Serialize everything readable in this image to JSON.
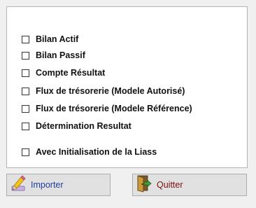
{
  "options": [
    {
      "label": "Bilan Actif",
      "checked": false
    },
    {
      "label": "Bilan Passif",
      "checked": false
    },
    {
      "label": "Compte Résultat",
      "checked": false
    },
    {
      "label": "Flux de trésorerie (Modele Autorisé)",
      "checked": false
    },
    {
      "label": "Flux de trésorerie (Modele Référence)",
      "checked": false
    },
    {
      "label": "Détermination Resultat",
      "checked": false
    }
  ],
  "init_option": {
    "label": "Avec Initialisation de la Liass",
    "checked": false
  },
  "buttons": {
    "import_label": "Importer",
    "import_icon": "pencil-icon",
    "quit_label": "Quitter",
    "quit_icon": "exit-door-icon"
  },
  "colors": {
    "import_text": "#1f3e9a",
    "quit_text": "#7a1010"
  }
}
